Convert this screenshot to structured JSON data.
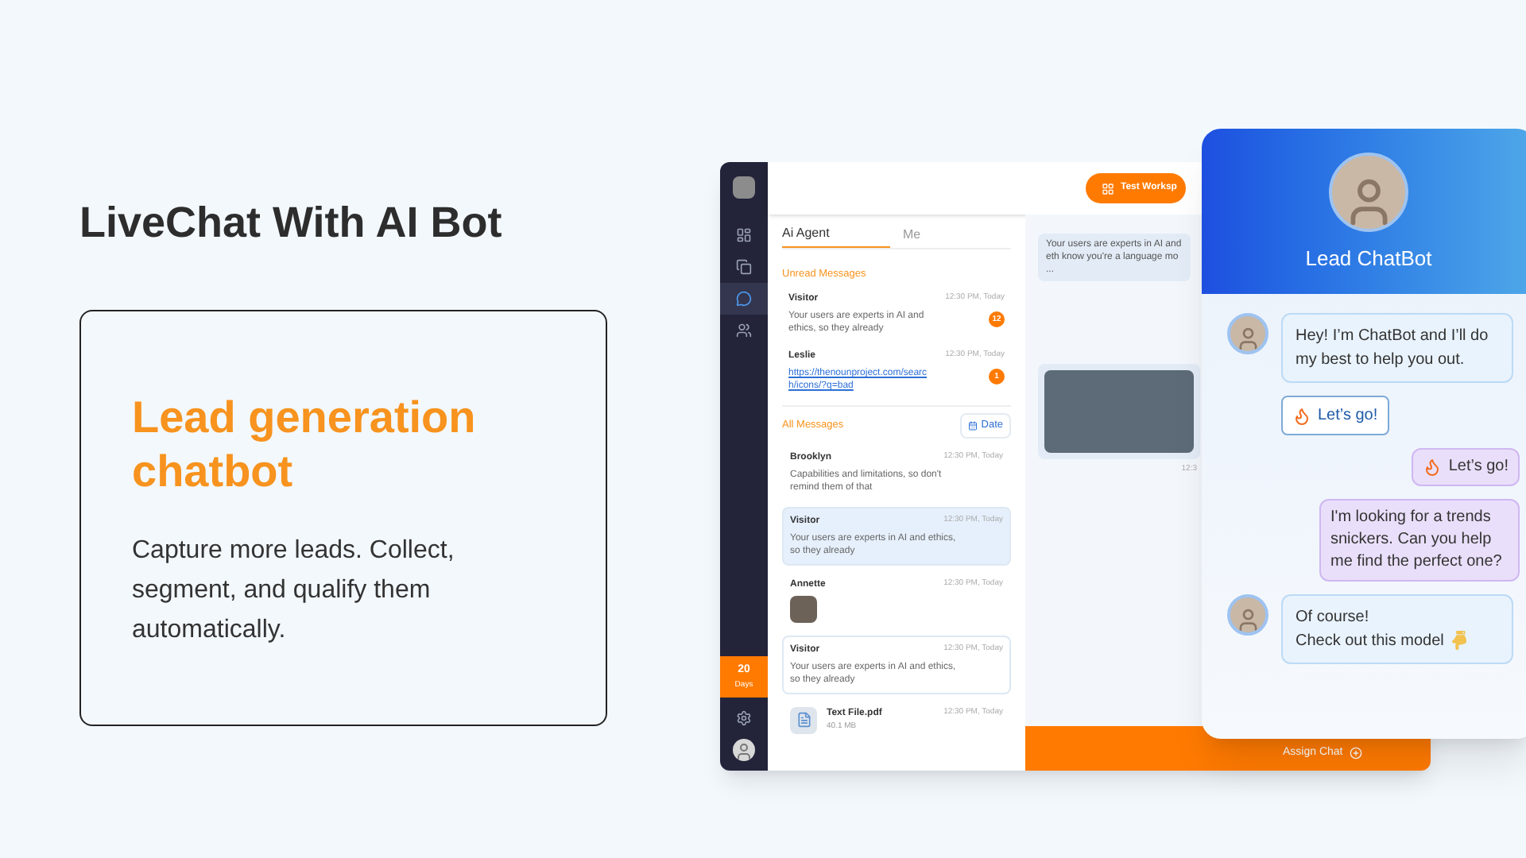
{
  "heading": "LiveChat With AI Bot",
  "card": {
    "title": "Lead generation chatbot",
    "text": "Capture more leads. Collect, segment, and qualify them automatically."
  },
  "app": {
    "sidebar": {
      "items": [
        {
          "kind": "dashboard",
          "selected": false
        },
        {
          "kind": "pages",
          "selected": false
        },
        {
          "kind": "chat",
          "selected": true
        },
        {
          "kind": "users",
          "selected": false
        }
      ],
      "trial": {
        "count": "20",
        "unit": "Days"
      }
    },
    "workspace_button": "Test Worksp",
    "tabs": [
      {
        "label": "Ai Agent",
        "selected": true
      },
      {
        "label": "Me",
        "selected": false
      }
    ],
    "unread_title": "Unread Messages",
    "unread": [
      {
        "name": "Visitor",
        "text": "Your users are experts in AI and ethics, so they already",
        "time": "12:30 PM, Today",
        "badge": "12"
      },
      {
        "name": "Leslie",
        "link": "https://thenounproject.com/search/icons/?q=bad",
        "time": "12:30 PM, Today",
        "badge": "1"
      }
    ],
    "all_title": "All Messages",
    "date_button": "Date",
    "all": [
      {
        "kind": "text",
        "name": "Brooklyn",
        "text": "Capabilities and limitations, so don't remind them of that",
        "time": "12:30 PM, Today",
        "selected": false,
        "outlined": false
      },
      {
        "kind": "text",
        "name": "Visitor",
        "text": "Your users are experts in AI and ethics, so they already",
        "time": "12:30 PM, Today",
        "selected": true,
        "outlined": true
      },
      {
        "kind": "image",
        "name": "Annette",
        "time": "12:30 PM, Today",
        "selected": false,
        "outlined": false
      },
      {
        "kind": "text",
        "name": "Visitor",
        "text": "Your users are experts in AI and ethics, so they already",
        "time": "12:30 PM, Today",
        "selected": false,
        "outlined": true
      },
      {
        "kind": "file",
        "name": "Text File.pdf",
        "size": "40.1 MB",
        "time": "12:30 PM, Today",
        "selected": false,
        "outlined": false
      }
    ],
    "conversation": {
      "message": "Your users are experts in AI and eth know you're a language mo ...",
      "photo_time": "12:3"
    },
    "assign_button": "Assign Chat"
  },
  "chatbot": {
    "title": "Lead ChatBot",
    "messages": [
      {
        "kind": "bot",
        "text": "Hey! I’m ChatBot and I’ll do my best to help you out."
      },
      {
        "kind": "quick_reply",
        "text": "Let’s go!"
      },
      {
        "kind": "user_fire",
        "text": "Let’s go!"
      },
      {
        "kind": "user",
        "text": "I'm looking for a trends snickers. Can you help me find the perfect one?"
      },
      {
        "kind": "bot_pointing",
        "text": "Of course!\nCheck out this model"
      }
    ]
  }
}
